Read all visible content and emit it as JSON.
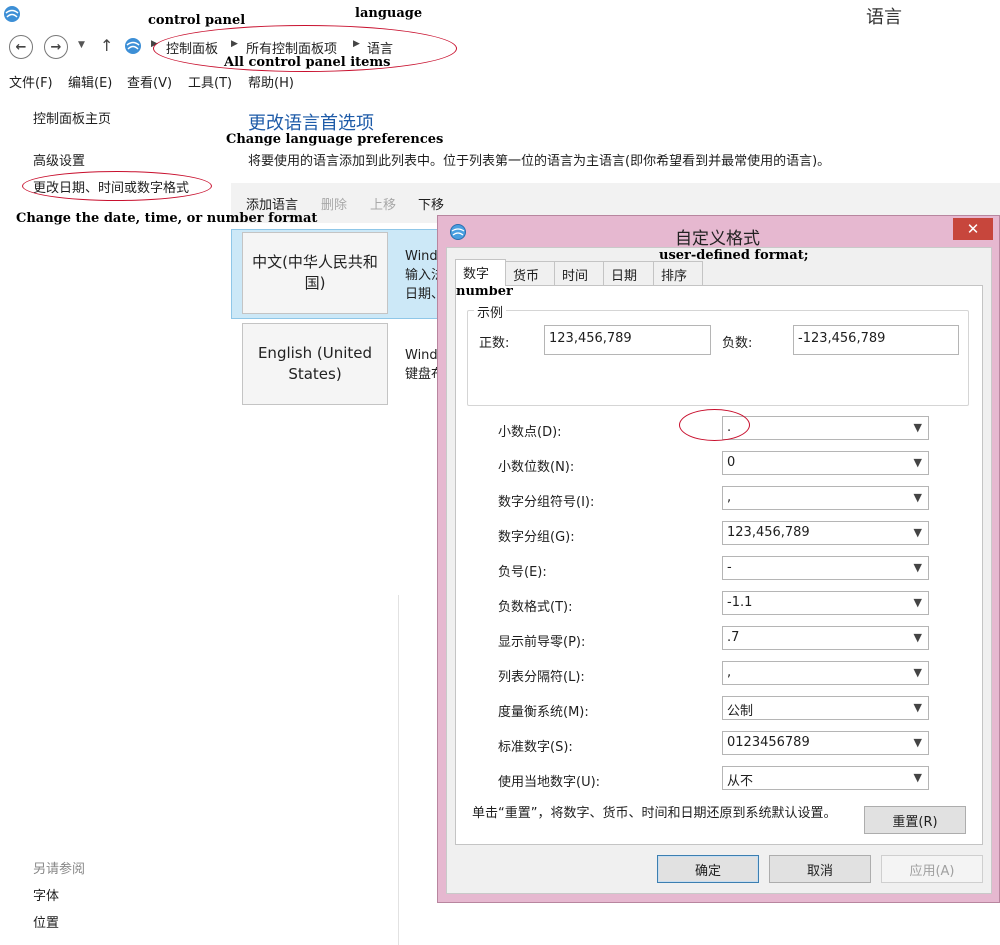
{
  "window": {
    "title": "语言"
  },
  "breadcrumb": [
    "控制面板",
    "所有控制面板项",
    "语言"
  ],
  "menu": [
    "文件(F)",
    "编辑(E)",
    "查看(V)",
    "工具(T)",
    "帮助(H)"
  ],
  "left_nav": {
    "home": "控制面板主页",
    "advanced": "高级设置",
    "date_time_format": "更改日期、时间或数字格式",
    "see_also": "另请参阅",
    "fonts": "字体",
    "location": "位置"
  },
  "main": {
    "title": "更改语言首选项",
    "description": "将要使用的语言添加到此列表中。位于列表第一位的语言为主语言(即你希望看到并最常使用的语言)。",
    "toolbar": {
      "add": "添加语言",
      "remove": "删除",
      "move_up": "上移",
      "move_down": "下移"
    },
    "languages": [
      {
        "name": "中文(中华人民共和国)",
        "info": "Wind\n输入法\n日期、"
      },
      {
        "name": "English (United States)",
        "info": "Wind\n键盘布"
      }
    ]
  },
  "dialog": {
    "title": "自定义格式",
    "close": "✕",
    "tabs": [
      "数字",
      "货币",
      "时间",
      "日期",
      "排序"
    ],
    "sample_legend": "示例",
    "positive_label": "正数:",
    "positive_value": "123,456,789",
    "negative_label": "负数:",
    "negative_value": "-123,456,789",
    "fields": [
      {
        "label": "小数点(D):",
        "value": "."
      },
      {
        "label": "小数位数(N):",
        "value": "0"
      },
      {
        "label": "数字分组符号(I):",
        "value": ","
      },
      {
        "label": "数字分组(G):",
        "value": "123,456,789"
      },
      {
        "label": "负号(E):",
        "value": "-"
      },
      {
        "label": "负数格式(T):",
        "value": "-1.1"
      },
      {
        "label": "显示前导零(P):",
        "value": ".7"
      },
      {
        "label": "列表分隔符(L):",
        "value": ","
      },
      {
        "label": "度量衡系统(M):",
        "value": "公制"
      },
      {
        "label": "标准数字(S):",
        "value": "0123456789"
      },
      {
        "label": "使用当地数字(U):",
        "value": "从不"
      }
    ],
    "note": "单击“重置”，将数字、货币、时间和日期还原到系统默认设置。",
    "reset": "重置(R)",
    "ok": "确定",
    "cancel": "取消",
    "apply": "应用(A)"
  },
  "annotations": {
    "control_panel": "control panel",
    "language": "language",
    "all_items": "All control panel items",
    "change_prefs": "Change language preferences",
    "change_format": "Change the date, time, or number format",
    "user_defined": "user-defined format;",
    "number": "number"
  }
}
